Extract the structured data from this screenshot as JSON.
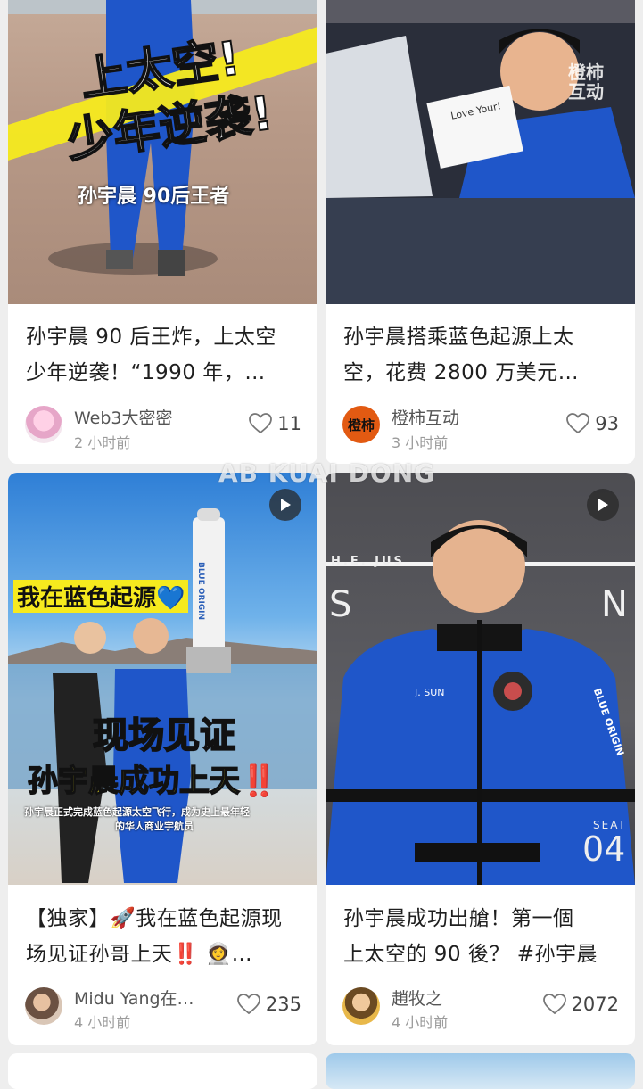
{
  "watermark": "AB KUAI DONG",
  "cards": [
    {
      "overlay": {
        "line1": "上太空!",
        "line2": "少年逆袭!",
        "caption": "孙宇晨 90后王者"
      },
      "title_line1": "孙宇晨 90 后王炸，上太空",
      "title_line2": "少年逆袭！“1990 年，…",
      "author": "Web3大密密",
      "time": "2 小时前",
      "likes": "11"
    },
    {
      "overlay": {
        "logo": "橙柿\n互动",
        "note": "Love Your!"
      },
      "title_line1": "孙宇晨搭乘蓝色起源上太",
      "title_line2": "空，花费 2800 万美元…",
      "author": "橙柿互动",
      "avatar_text": "橙柿",
      "time": "3 小时前",
      "likes": "93"
    },
    {
      "overlay": {
        "line1": "我在蓝色起源💙",
        "line2": "现场见证",
        "line3": "孙宇晨成功上天‼️",
        "sub1": "孙宇晨正式完成蓝色起源太空飞行，成为史上最年轻",
        "sub2": "的华人商业宇航员",
        "rocket": "BLUE ORIGIN"
      },
      "title_line1": "【独家】🚀我在蓝色起源现",
      "title_line2": "场见证孙哥上天‼️ 👩‍🚀…",
      "author": "Midu Yang在…",
      "time": "4 小时前",
      "likes": "235"
    },
    {
      "overlay": {
        "banner": "H.E. JUS",
        "s": "S",
        "n": "N",
        "patch": "J. SUN",
        "seat": "SEAT",
        "seat_no": "04",
        "sleeve": "BLUE ORIGIN"
      },
      "title_line1": "孙宇晨成功出艙！第一個",
      "title_line2": "上太空的 90 後？ #孙宇晨",
      "author": "趙牧之",
      "time": "4 小时前",
      "likes": "2072"
    }
  ],
  "colors": {
    "accent_yellow": "#f6ea1e",
    "suit_blue": "#1f56c9",
    "sky_blue": "#3d93e0"
  }
}
